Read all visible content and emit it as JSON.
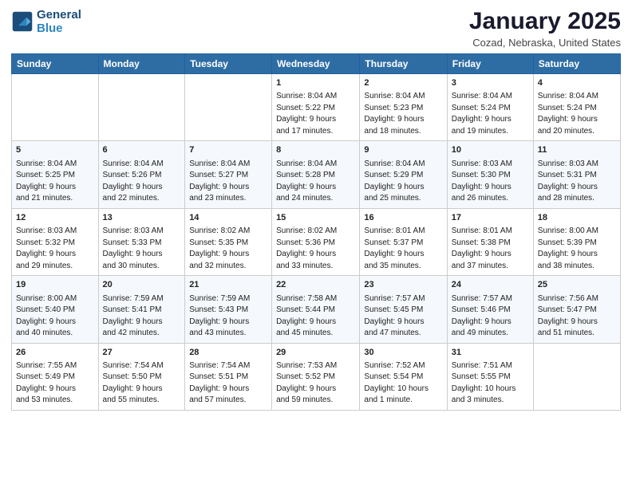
{
  "header": {
    "logo_line1": "General",
    "logo_line2": "Blue",
    "title": "January 2025",
    "subtitle": "Cozad, Nebraska, United States"
  },
  "weekdays": [
    "Sunday",
    "Monday",
    "Tuesday",
    "Wednesday",
    "Thursday",
    "Friday",
    "Saturday"
  ],
  "weeks": [
    [
      {
        "day": "",
        "info": ""
      },
      {
        "day": "",
        "info": ""
      },
      {
        "day": "",
        "info": ""
      },
      {
        "day": "1",
        "info": "Sunrise: 8:04 AM\nSunset: 5:22 PM\nDaylight: 9 hours\nand 17 minutes."
      },
      {
        "day": "2",
        "info": "Sunrise: 8:04 AM\nSunset: 5:23 PM\nDaylight: 9 hours\nand 18 minutes."
      },
      {
        "day": "3",
        "info": "Sunrise: 8:04 AM\nSunset: 5:24 PM\nDaylight: 9 hours\nand 19 minutes."
      },
      {
        "day": "4",
        "info": "Sunrise: 8:04 AM\nSunset: 5:24 PM\nDaylight: 9 hours\nand 20 minutes."
      }
    ],
    [
      {
        "day": "5",
        "info": "Sunrise: 8:04 AM\nSunset: 5:25 PM\nDaylight: 9 hours\nand 21 minutes."
      },
      {
        "day": "6",
        "info": "Sunrise: 8:04 AM\nSunset: 5:26 PM\nDaylight: 9 hours\nand 22 minutes."
      },
      {
        "day": "7",
        "info": "Sunrise: 8:04 AM\nSunset: 5:27 PM\nDaylight: 9 hours\nand 23 minutes."
      },
      {
        "day": "8",
        "info": "Sunrise: 8:04 AM\nSunset: 5:28 PM\nDaylight: 9 hours\nand 24 minutes."
      },
      {
        "day": "9",
        "info": "Sunrise: 8:04 AM\nSunset: 5:29 PM\nDaylight: 9 hours\nand 25 minutes."
      },
      {
        "day": "10",
        "info": "Sunrise: 8:03 AM\nSunset: 5:30 PM\nDaylight: 9 hours\nand 26 minutes."
      },
      {
        "day": "11",
        "info": "Sunrise: 8:03 AM\nSunset: 5:31 PM\nDaylight: 9 hours\nand 28 minutes."
      }
    ],
    [
      {
        "day": "12",
        "info": "Sunrise: 8:03 AM\nSunset: 5:32 PM\nDaylight: 9 hours\nand 29 minutes."
      },
      {
        "day": "13",
        "info": "Sunrise: 8:03 AM\nSunset: 5:33 PM\nDaylight: 9 hours\nand 30 minutes."
      },
      {
        "day": "14",
        "info": "Sunrise: 8:02 AM\nSunset: 5:35 PM\nDaylight: 9 hours\nand 32 minutes."
      },
      {
        "day": "15",
        "info": "Sunrise: 8:02 AM\nSunset: 5:36 PM\nDaylight: 9 hours\nand 33 minutes."
      },
      {
        "day": "16",
        "info": "Sunrise: 8:01 AM\nSunset: 5:37 PM\nDaylight: 9 hours\nand 35 minutes."
      },
      {
        "day": "17",
        "info": "Sunrise: 8:01 AM\nSunset: 5:38 PM\nDaylight: 9 hours\nand 37 minutes."
      },
      {
        "day": "18",
        "info": "Sunrise: 8:00 AM\nSunset: 5:39 PM\nDaylight: 9 hours\nand 38 minutes."
      }
    ],
    [
      {
        "day": "19",
        "info": "Sunrise: 8:00 AM\nSunset: 5:40 PM\nDaylight: 9 hours\nand 40 minutes."
      },
      {
        "day": "20",
        "info": "Sunrise: 7:59 AM\nSunset: 5:41 PM\nDaylight: 9 hours\nand 42 minutes."
      },
      {
        "day": "21",
        "info": "Sunrise: 7:59 AM\nSunset: 5:43 PM\nDaylight: 9 hours\nand 43 minutes."
      },
      {
        "day": "22",
        "info": "Sunrise: 7:58 AM\nSunset: 5:44 PM\nDaylight: 9 hours\nand 45 minutes."
      },
      {
        "day": "23",
        "info": "Sunrise: 7:57 AM\nSunset: 5:45 PM\nDaylight: 9 hours\nand 47 minutes."
      },
      {
        "day": "24",
        "info": "Sunrise: 7:57 AM\nSunset: 5:46 PM\nDaylight: 9 hours\nand 49 minutes."
      },
      {
        "day": "25",
        "info": "Sunrise: 7:56 AM\nSunset: 5:47 PM\nDaylight: 9 hours\nand 51 minutes."
      }
    ],
    [
      {
        "day": "26",
        "info": "Sunrise: 7:55 AM\nSunset: 5:49 PM\nDaylight: 9 hours\nand 53 minutes."
      },
      {
        "day": "27",
        "info": "Sunrise: 7:54 AM\nSunset: 5:50 PM\nDaylight: 9 hours\nand 55 minutes."
      },
      {
        "day": "28",
        "info": "Sunrise: 7:54 AM\nSunset: 5:51 PM\nDaylight: 9 hours\nand 57 minutes."
      },
      {
        "day": "29",
        "info": "Sunrise: 7:53 AM\nSunset: 5:52 PM\nDaylight: 9 hours\nand 59 minutes."
      },
      {
        "day": "30",
        "info": "Sunrise: 7:52 AM\nSunset: 5:54 PM\nDaylight: 10 hours\nand 1 minute."
      },
      {
        "day": "31",
        "info": "Sunrise: 7:51 AM\nSunset: 5:55 PM\nDaylight: 10 hours\nand 3 minutes."
      },
      {
        "day": "",
        "info": ""
      }
    ]
  ]
}
